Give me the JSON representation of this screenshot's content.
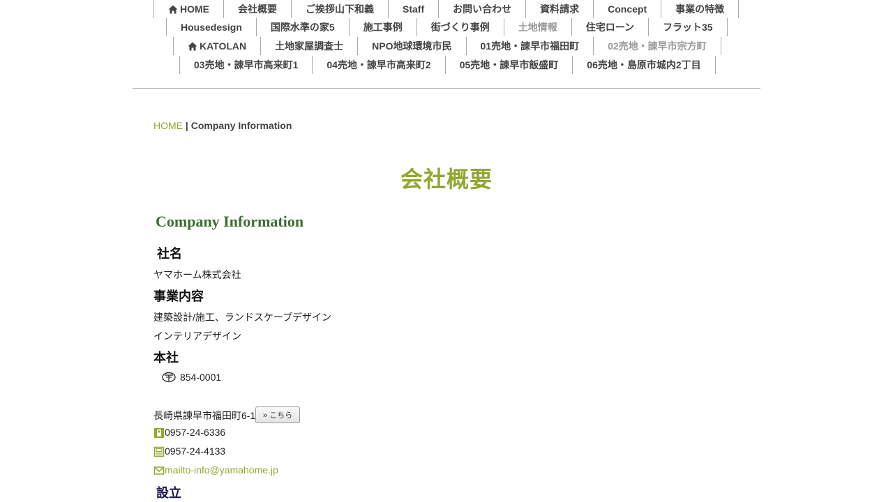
{
  "nav": {
    "rows": [
      [
        {
          "label": "HOME",
          "home_icon": true
        },
        {
          "label": "会社概要"
        },
        {
          "label": "ご挨拶山下和義"
        },
        {
          "label": "Staff"
        },
        {
          "label": "お問い合わせ"
        },
        {
          "label": "資料請求"
        },
        {
          "label": "Concept"
        },
        {
          "label": "事業の特徴"
        }
      ],
      [
        {
          "label": "Housedesign"
        },
        {
          "label": "国際水準の家5"
        },
        {
          "label": "施工事例"
        },
        {
          "label": "街づくり事例"
        },
        {
          "label": "土地情報",
          "muted": true
        },
        {
          "label": "住宅ローン"
        },
        {
          "label": "フラット35"
        }
      ],
      [
        {
          "label": "KATOLAN",
          "home_icon": true
        },
        {
          "label": "土地家屋調査士"
        },
        {
          "label": "NPO地球環境市民"
        },
        {
          "label": "01売地・諌早市福田町"
        },
        {
          "label": "02売地・諌早市宗方町",
          "muted": true
        }
      ],
      [
        {
          "label": "03売地・諌早市高来町1"
        },
        {
          "label": "04売地・諌早市高来町2"
        },
        {
          "label": "05売地・諌早市飯盛町"
        },
        {
          "label": "06売地・島原市城内2丁目"
        }
      ]
    ]
  },
  "breadcrumb": {
    "home": "HOME",
    "separator": "|",
    "current": "Company Information"
  },
  "page_title": "会社概要",
  "section_heading": "Company Information",
  "company": {
    "name_label": "社名",
    "name_value": "ヤマホーム株式会社",
    "business_label": "事業内容",
    "business_line1": "建築設計/施工、ランドスケープデザイン",
    "business_line2": "インテリアデザイン",
    "hq_label": "本社",
    "postal_code": "854-0001",
    "address": "長崎県諫早市福田町6-1",
    "map_button": "» こちら",
    "tel": "0957-24-6336",
    "fax": "0957-24-4133",
    "email": "mailto-info@yamahome.jp",
    "established_label": "設立"
  },
  "colors": {
    "accent": "#8fa832",
    "heading_green": "#3d6b35"
  }
}
